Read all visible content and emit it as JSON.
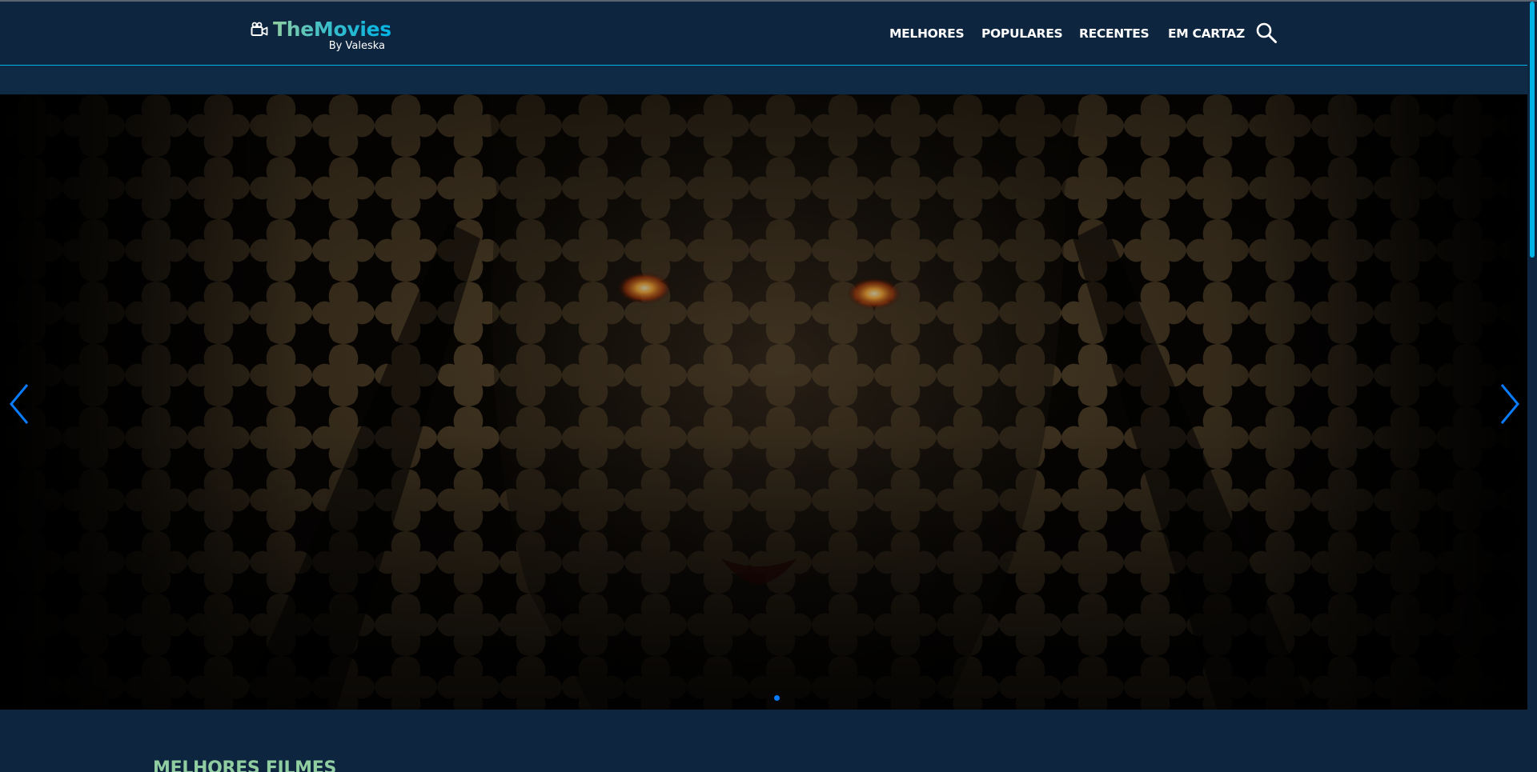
{
  "brand": {
    "name": "TheMovies",
    "byline": "By Valeska",
    "icon": "movie-camera-icon"
  },
  "nav": {
    "items": [
      {
        "label": "MELHORES"
      },
      {
        "label": "POPULARES"
      },
      {
        "label": "RECENTES"
      },
      {
        "label": "EM CARTAZ"
      }
    ],
    "search_icon": "search-icon"
  },
  "carousel": {
    "prev_icon": "chevron-left-icon",
    "next_icon": "chevron-right-icon",
    "slide_count": 1,
    "active_slide": 1
  },
  "section": {
    "title": "MELHORES FILMES"
  },
  "colors": {
    "background": "#0d253f",
    "accent_green": "#90cea1",
    "accent_blue": "#01b4e4",
    "arrow": "#0a7cff"
  }
}
